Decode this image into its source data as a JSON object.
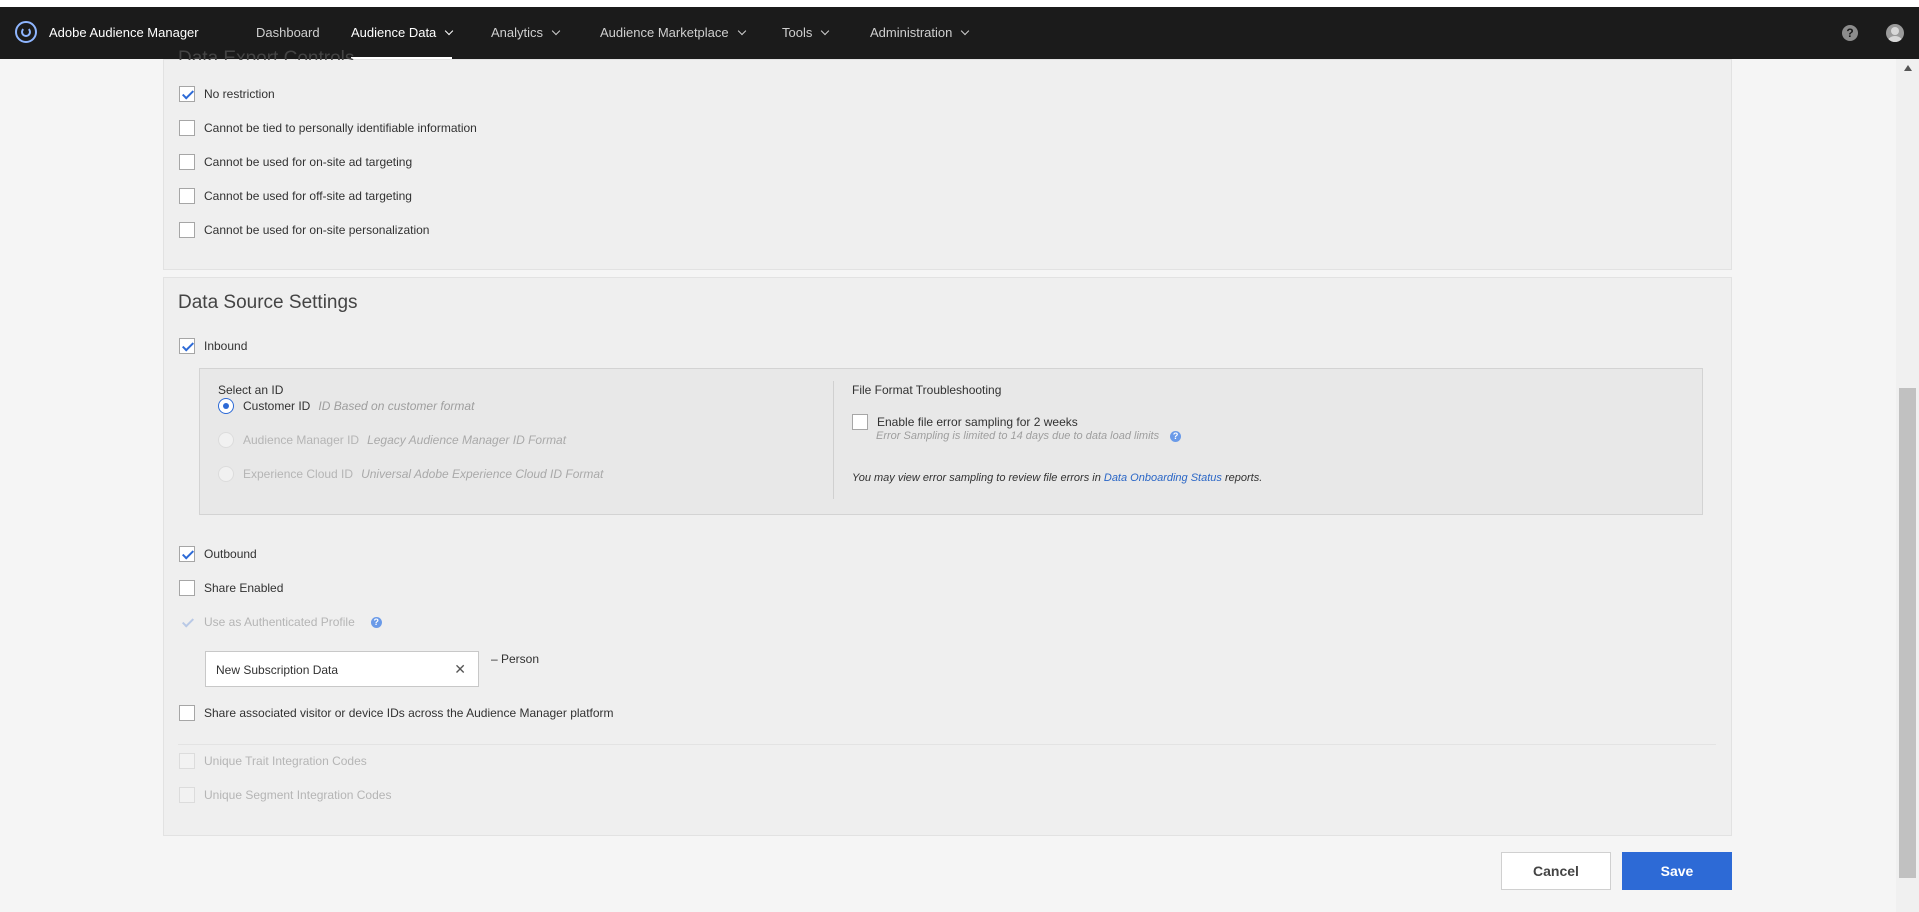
{
  "nav": {
    "brand": "Adobe Audience Manager",
    "items": [
      {
        "label": "Dashboard"
      },
      {
        "label": "Audience Data"
      },
      {
        "label": "Analytics"
      },
      {
        "label": "Audience Marketplace"
      },
      {
        "label": "Tools"
      },
      {
        "label": "Administration"
      }
    ],
    "active": "Audience Data",
    "help_glyph": "?"
  },
  "data_export_controls": {
    "title": "Data Export Controls",
    "options": [
      {
        "label": "No restriction",
        "checked": true
      },
      {
        "label": "Cannot be tied to personally identifiable information",
        "checked": false
      },
      {
        "label": "Cannot be used for on-site ad targeting",
        "checked": false
      },
      {
        "label": "Cannot be used for off-site ad targeting",
        "checked": false
      },
      {
        "label": "Cannot be used for on-site personalization",
        "checked": false
      }
    ]
  },
  "data_source_settings": {
    "title": "Data Source Settings",
    "inbound": {
      "label": "Inbound",
      "checked": true
    },
    "select_id": {
      "title": "Select an ID",
      "options": [
        {
          "label": "Customer ID",
          "desc": "ID Based on customer format",
          "selected": true
        },
        {
          "label": "Audience Manager ID",
          "desc": "Legacy Audience Manager ID Format",
          "selected": false
        },
        {
          "label": "Experience Cloud ID",
          "desc": "Universal Adobe Experience Cloud ID Format",
          "selected": false
        }
      ]
    },
    "troubleshooting": {
      "title": "File Format Troubleshooting",
      "enable_label": "Enable file error sampling for 2 weeks",
      "limit_note": "Error Sampling is limited to 14 days due to data load limits",
      "view_note_prefix": "You may view error sampling to review file errors in ",
      "link_text": "Data Onboarding Status",
      "view_note_suffix": " reports."
    },
    "outbound": {
      "label": "Outbound",
      "checked": true
    },
    "share_enabled": {
      "label": "Share Enabled",
      "checked": false
    },
    "authenticated_profile": {
      "label": "Use as Authenticated Profile",
      "checked": true,
      "disabled": true
    },
    "profile_tag": {
      "value": "New Subscription Data",
      "suffix": "– Person",
      "clear_glyph": "✕"
    },
    "share_ids": {
      "label": "Share associated visitor or device IDs across the Audience Manager platform",
      "checked": false
    },
    "unique_trait": {
      "label": "Unique Trait Integration Codes",
      "disabled": true
    },
    "unique_segment": {
      "label": "Unique Segment Integration Codes",
      "disabled": true
    }
  },
  "actions": {
    "cancel": "Cancel",
    "save": "Save"
  },
  "colors": {
    "accent": "#2d6ad6",
    "nav_bg": "#1b1b1b",
    "link": "#2a66c6"
  }
}
